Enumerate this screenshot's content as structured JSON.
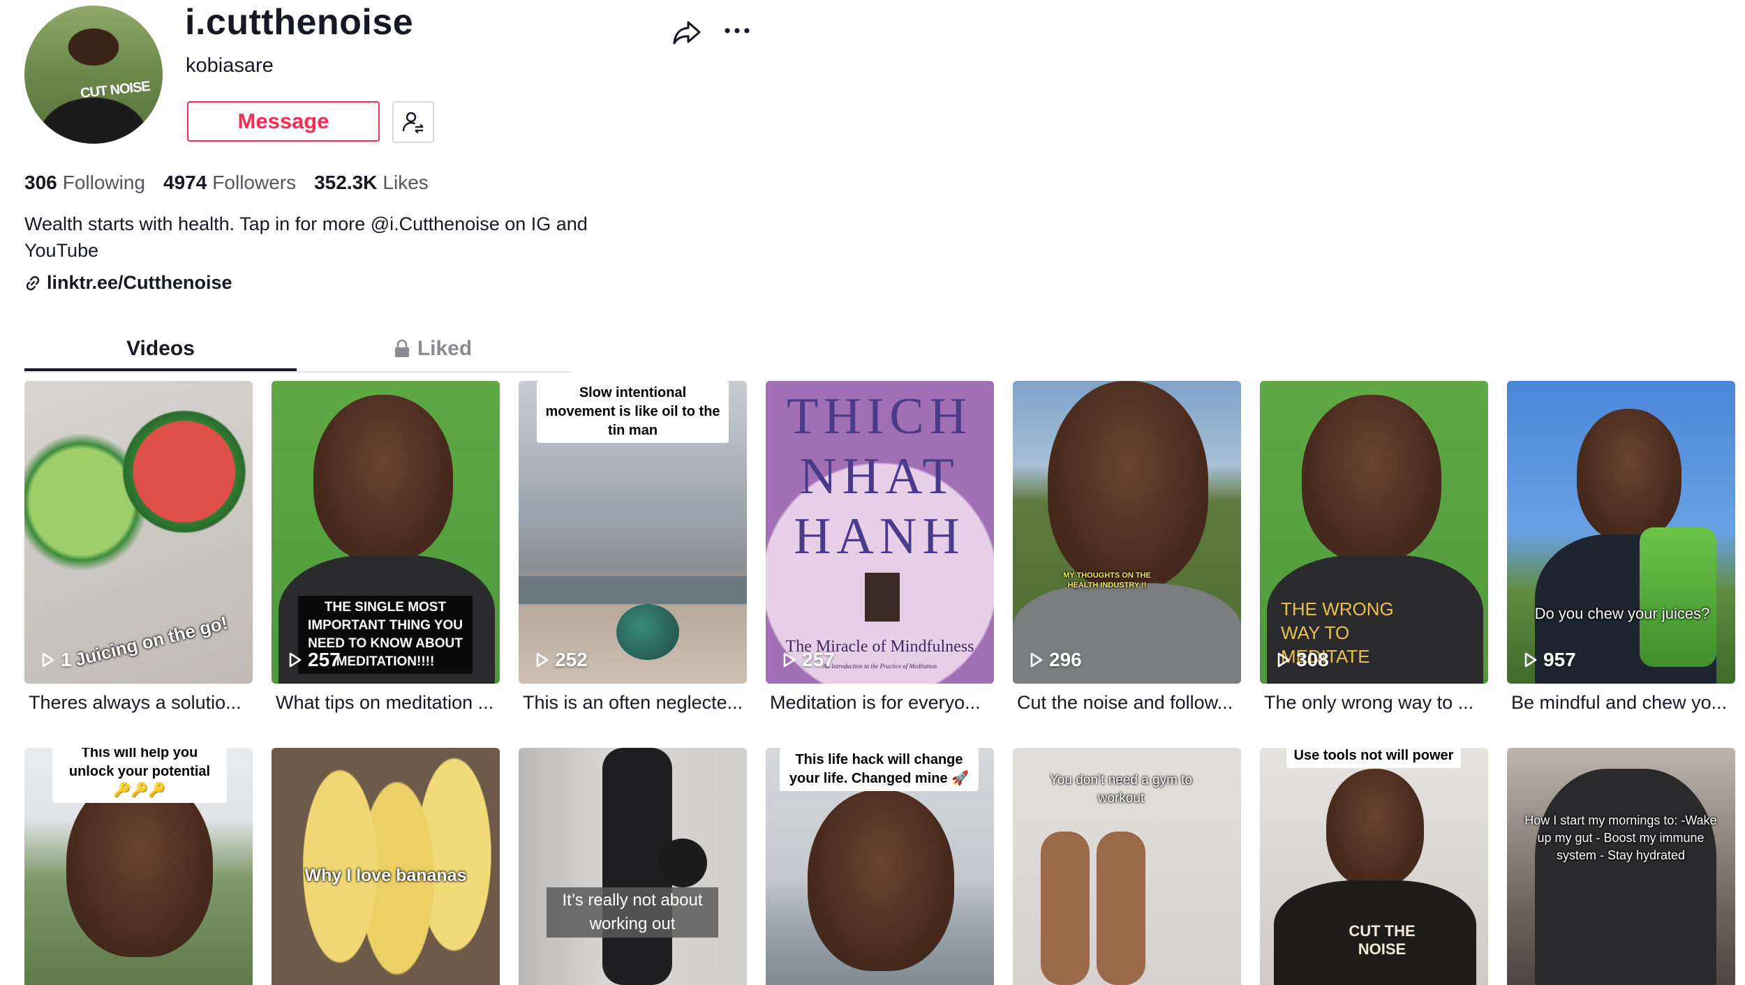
{
  "profile": {
    "username": "i.cutthenoise",
    "nickname": "kobiasare",
    "avatar_text": "CUT NOISE",
    "message_button": "Message",
    "stats": [
      {
        "value": "306",
        "label": "Following"
      },
      {
        "value": "4974",
        "label": "Followers"
      },
      {
        "value": "352.3K",
        "label": "Likes"
      }
    ],
    "bio": "Wealth starts with health. Tap in for more @i.Cutthenoise on IG and YouTube",
    "link": "linktr.ee/Cutthenoise"
  },
  "icons": {
    "share": "share-icon",
    "more": "more-icon",
    "follow_switch": "person-switch-icon",
    "link": "link-icon",
    "lock": "lock-icon",
    "play": "play-icon"
  },
  "tabs": [
    {
      "label": "Videos",
      "active": true
    },
    {
      "label": "Liked",
      "active": false
    }
  ],
  "videos_row1": [
    {
      "overlay": "Juicing on the go!",
      "views": "1",
      "caption": "Theres always a solutio..."
    },
    {
      "overlay": "THE SINGLE MOST IMPORTANT THING YOU NEED TO KNOW ABOUT MEDITATION!!!!",
      "views": "257",
      "caption": "What tips on meditation ..."
    },
    {
      "overlay": "Slow intentional movement is like oil to the tin man",
      "views": "252",
      "caption": "This is an often neglecte..."
    },
    {
      "overlay_top": "THICH NHAT HANH",
      "overlay_bottom": "The Miracle of Mindfulness",
      "overlay_small": "An Introduction to the Practice of Meditation",
      "views": "257",
      "caption": "Meditation is for everyo..."
    },
    {
      "overlay": "MY THOUGHTS ON THE HEALTH INDUSTRY !!",
      "views": "296",
      "caption": "Cut the noise and follow..."
    },
    {
      "overlay": "THE WRONG WAY TO MEDITATE",
      "views": "308",
      "caption": "The only wrong way to ..."
    },
    {
      "overlay": "Do you chew your juices?",
      "views": "957",
      "caption": "Be mindful and chew yo..."
    }
  ],
  "videos_row2": [
    {
      "overlay": "This will help you unlock your potential 🔑🔑🔑"
    },
    {
      "overlay": "Why I love bananas"
    },
    {
      "overlay": "It’s really not about working out"
    },
    {
      "overlay": "This life hack will change your life. Changed mine 🚀"
    },
    {
      "overlay": "You don’t need a gym to workout"
    },
    {
      "overlay": "Use tools not will power",
      "shirt_text": "CUT THE NOISE"
    },
    {
      "overlay": "How I start my mornings to: -Wake up my gut - Boost my immune system - Stay hydrated"
    }
  ],
  "colors": {
    "brand_red": "#fe2c55",
    "text_primary": "#161823",
    "text_secondary": "#8a8b91"
  }
}
